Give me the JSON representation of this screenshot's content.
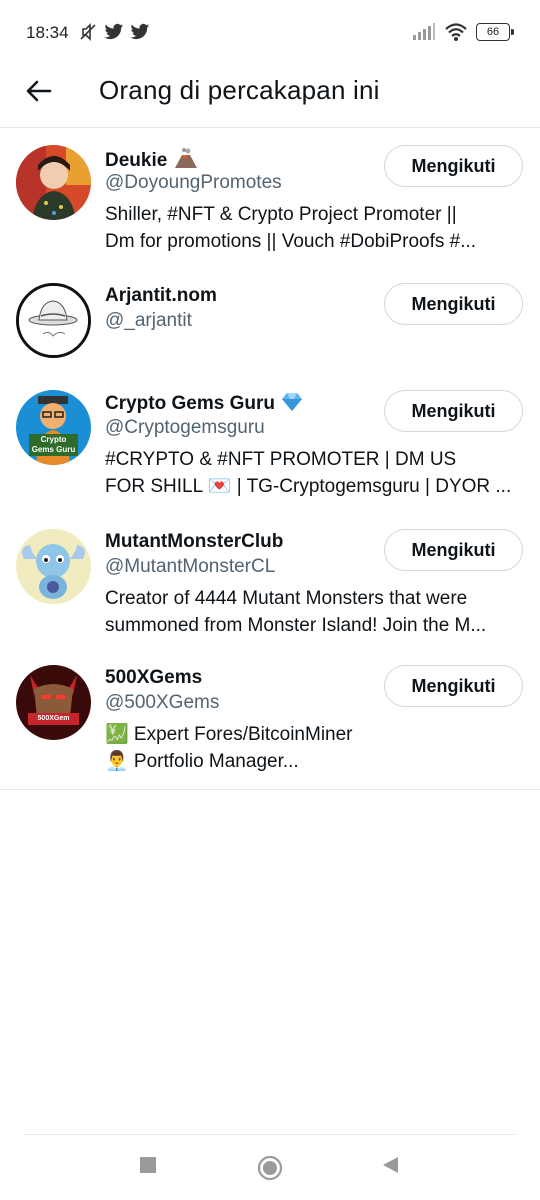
{
  "status_bar": {
    "time": "18:34",
    "battery": "66"
  },
  "header": {
    "title": "Orang di percakapan ini"
  },
  "users": [
    {
      "name": "Deukie",
      "name_badge": "volcano-emoji",
      "handle": "@DoyoungPromotes",
      "bio": [
        "Shiller, #NFT & Crypto Project Promoter ||",
        "Dm for promotions || Vouch #DobiProofs  #..."
      ],
      "button_label": "Mengikuti",
      "avatar_colors": [
        "#d64a2a",
        "#2c3a2a"
      ]
    },
    {
      "name": "Arjantit.nom",
      "handle": "@_arjantit",
      "bio": [],
      "button_label": "Mengikuti",
      "avatar_colors": [
        "#ffffff",
        "#111111"
      ]
    },
    {
      "name": "Crypto Gems Guru",
      "name_badge": "gem-emoji",
      "handle": "@Cryptogemsguru",
      "bio": [
        "#CRYPTO & #NFT PROMOTER | DM US",
        "FOR SHILL 💌 | TG-Cryptogemsguru | DYOR ..."
      ],
      "button_label": "Mengikuti",
      "avatar_text": [
        "Crypto",
        "Gems Guru"
      ],
      "avatar_colors": [
        "#1a8fd6",
        "#2f6b2a"
      ]
    },
    {
      "name": "MutantMonsterClub",
      "handle": "@MutantMonsterCL",
      "bio": [
        "Creator of 4444 Mutant Monsters that were",
        "summoned from Monster Island! Join the M..."
      ],
      "button_label": "Mengikuti",
      "avatar_colors": [
        "#f1ecc0",
        "#8fc6e8"
      ]
    },
    {
      "name": "500XGems",
      "handle": "@500XGems",
      "bio": [
        "💹 Expert Fores/BitcoinMiner",
        "👨‍💼 Portfolio Manager..."
      ],
      "button_label": "Mengikuti",
      "avatar_text": [
        "500XGem"
      ],
      "avatar_colors": [
        "#3a0a0a",
        "#c4262b"
      ]
    }
  ],
  "colors": {
    "text_primary": "#0f1419",
    "text_secondary": "#536471",
    "border": "#cfd9de"
  }
}
